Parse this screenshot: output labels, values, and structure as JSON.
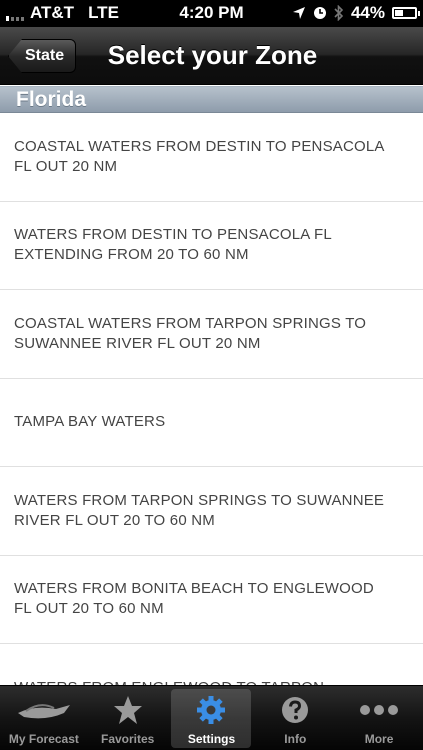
{
  "status_bar": {
    "carrier": "AT&T",
    "network": "LTE",
    "time": "4:20 PM",
    "battery_percent": "44%",
    "battery_level": 0.44
  },
  "nav": {
    "back_label": "State",
    "title": "Select your Zone"
  },
  "section": {
    "title": "Florida"
  },
  "zones": [
    {
      "line1": "COASTAL WATERS FROM DESTIN TO PENSACOLA",
      "line2": "FL OUT 20 NM"
    },
    {
      "line1": "WATERS FROM DESTIN TO PENSACOLA FL",
      "line2": "EXTENDING FROM 20 TO 60 NM"
    },
    {
      "line1": "COASTAL WATERS FROM TARPON SPRINGS TO",
      "line2": "SUWANNEE RIVER FL OUT 20 NM"
    },
    {
      "line1": "TAMPA BAY WATERS",
      "line2": ""
    },
    {
      "line1": "WATERS FROM TARPON SPRINGS TO SUWANNEE",
      "line2": "RIVER FL OUT 20 TO 60 NM"
    },
    {
      "line1": "WATERS FROM BONITA BEACH TO ENGLEWOOD",
      "line2": "FL OUT 20 TO 60 NM"
    },
    {
      "line1": "WATERS FROM ENGLEWOOD TO TARPON",
      "line2": ""
    }
  ],
  "tabs": [
    {
      "label": "My Forecast",
      "icon": "boat-icon",
      "active": false
    },
    {
      "label": "Favorites",
      "icon": "star-icon",
      "active": false
    },
    {
      "label": "Settings",
      "icon": "gear-icon",
      "active": true
    },
    {
      "label": "Info",
      "icon": "question-icon",
      "active": false
    },
    {
      "label": "More",
      "icon": "more-dots-icon",
      "active": false
    }
  ],
  "colors": {
    "active_tab_icon": "#3a8ee6",
    "section_header": "#9aa7b5"
  }
}
